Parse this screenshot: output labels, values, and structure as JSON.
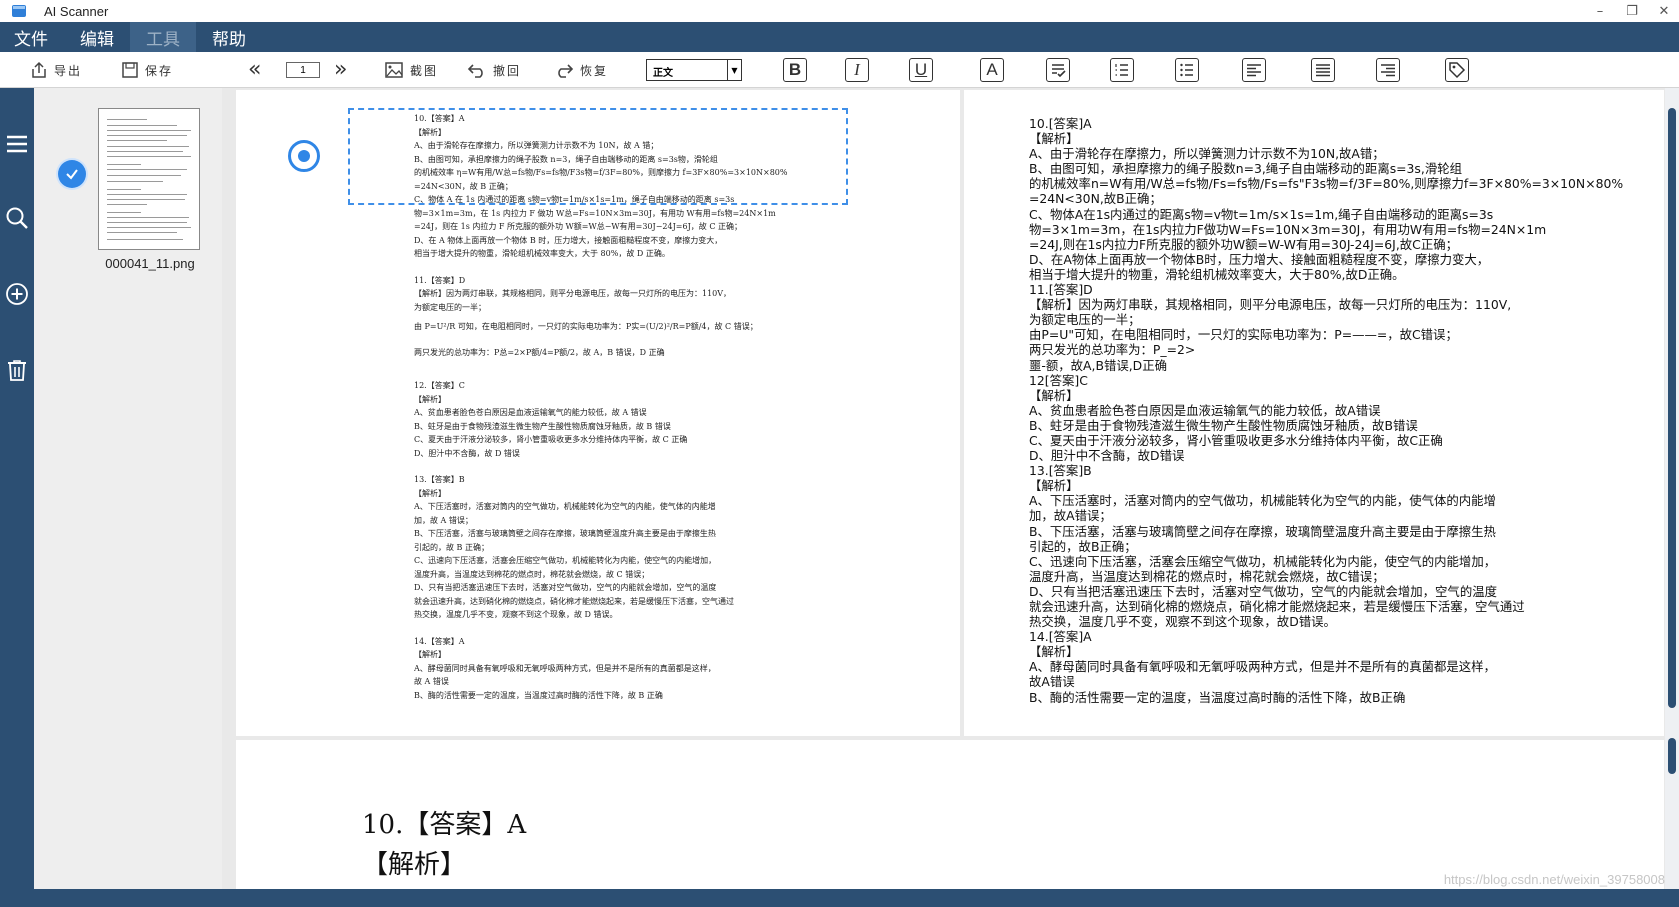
{
  "window": {
    "title": "AI Scanner",
    "minimize": "–",
    "restore": "❐",
    "close": "✕"
  },
  "menu": [
    "文件",
    "编辑",
    "工具",
    "帮助"
  ],
  "toolbar": {
    "export": "导出",
    "save": "保存",
    "page": "1",
    "screenshot": "截图",
    "undo": "撤回",
    "redo": "恢复",
    "style_value": "正文",
    "bold": "B",
    "italic": "I",
    "underline": "U",
    "font_color": "A"
  },
  "sidebar": {
    "thumbnail_name": "000041_11.png"
  },
  "source_doc": [
    "10.【答案】A",
    "【解析】",
    "    A、由于滑轮存在摩擦力，所以弹簧测力计示数不为 10N，故 A 错；",
    "    B、由图可知，承担摩擦力的绳子股数 n=3，绳子自由端移动的距离 s=3s物，滑轮组",
    "的机械效率 η=W有用/W总=fs物/Fs=fs物/F3s物=f/3F=80%，则摩擦力 f=3F×80%=3×10N×80%",
    "=24N<30N，故 B 正确；",
    "    C、物体 A 在 1s 内通过的距离 s物=v物t=1m/s×1s=1m，绳子自由端移动的距离 s=3s",
    "物=3×1m=3m，在 1s 内拉力 F 做功 W总=Fs=10N×3m=30J，有用功 W有用=fs物=24N×1m",
    "=24J，则在 1s 内拉力 F 所克服的额外功 W额=W总−W有用=30J−24J=6J，故 C 正确；",
    "    D、在 A 物体上面再放一个物体 B 时，压力增大，接触面粗糙程度不变，摩擦力变大，",
    "相当于增大提升的物重，滑轮组机械效率变大，大于 80%，故 D 正确。",
    "",
    "11.【答案】D",
    "【解析】因为两灯串联，其规格相同，则平分电源电压，故每一只灯所的电压为：110V，",
    "为额定电压的一半；",
    "由 P=U²/R 可知，在电阻相同时，一只灯的实际电功率为：P实=(U/2)²/R=P额/4，故 C 错误；",
    "两只发光的总功率为：P总=2×P额/4=P额/2，故 A，B 错误，D 正确",
    "",
    "12.【答案】C",
    "【解析】",
    "    A、贫血患者脸色苍白原因是血液运输氧气的能力较低，故 A 错误",
    "    B、蛀牙是由于食物残渣滋生微生物产生酸性物质腐蚀牙釉质，故 B 错误",
    "    C、夏天由于汗液分泌较多，肾小管重吸收更多水分维持体内平衡，故 C 正确",
    "    D、胆汁中不含酶，故 D 错误",
    "",
    "13.【答案】B",
    "【解析】",
    "    A、下压活塞时，活塞对筒内的空气做功，机械能转化为空气的内能，使气体的内能增",
    "加，故 A 错误；",
    "    B、下压活塞，活塞与玻璃筒壁之间存在摩擦，玻璃筒壁温度升高主要是由于摩擦生热",
    "引起的，故 B 正确；",
    "    C、迅速向下压活塞，活塞会压缩空气做功，机械能转化为内能，使空气的内能增加，",
    "温度升高，当温度达到棉花的燃点时，棉花就会燃烧，故 C 错误；",
    "    D、只有当把活塞迅速压下去时，活塞对空气做功，空气的内能就会增加，空气的温度",
    "就会迅速升高，达到硝化棉的燃烧点，硝化棉才能燃烧起来，若是缓慢压下活塞，空气通过",
    "热交换，温度几乎不变，观察不到这个现象，故 D 错误。",
    "",
    "14.【答案】A",
    "【解析】",
    "    A、酵母菌同时具备有氧呼吸和无氧呼吸两种方式，但是并不是所有的真菌都是这样，",
    "故 A 错误",
    "    B、酶的活性需要一定的温度，当温度过高时酶的活性下降，故 B 正确"
  ],
  "ocr_text": [
    "10.[答案]A",
    "【解析】",
    "A、由于滑轮存在摩擦力，所以弹簧测力计示数不为10N,故A错；",
    "B、由图可知，承担摩擦力的绳子股数n=3,绳子自由端移动的距离s=3s,滑轮组",
    "的机械效率n=W有用/W总=fs物/Fs=fs物/Fs=fs\"F3s物=f/3F=80%,则摩擦力f=3F×80%=3×10N×80%",
    "=24N<30N,故B正确；",
    "C、物体A在1s内通过的距离s物=v物t=1m/s×1s=1m,绳子自由端移动的距离s=3s",
    "物=3×1m=3m，在1s内拉力F做功W=Fs=10N×3m=30J，有用功W有用=fs物=24N×1m",
    "=24J,则在1s内拉力F所克服的额外功W额=W-W有用=30J-24J=6J,故C正确；",
    "D、在A物体上面再放一个物体B时，压力增大、接触面粗糙程度不变，摩擦力变大，",
    "相当于增大提升的物重，滑轮组机械效率变大，大于80%,故D正确。",
    "11.[答案]D",
    "【解析】因为两灯串联，其规格相同，则平分电源电压，故每一只灯所的电压为：110V,",
    "为额定电压的一半；",
    "由P=U\"可知，在电阻相同时，一只灯的实际电功率为：P=——=，故C错误；",
    "两只发光的总功率为：P_=2>",
    "噩-额，故A,B错误,D正确",
    "12[答案]C",
    "【解析】",
    "A、贫血患者脸色苍白原因是血液运输氧气的能力较低，故A错误",
    "B、蛀牙是由于食物残渣滋生微生物产生酸性物质腐蚀牙釉质，故B错误",
    "C、夏天由于汗液分泌较多，肾小管重吸收更多水分维持体内平衡，故C正确",
    "D、胆汁中不含酶，故D错误",
    "13.[答案]B",
    "【解析】",
    "A、下压活塞时，活塞对筒内的空气做功，机械能转化为空气的内能，使气体的内能增",
    "加，故A错误；",
    "B、下压活塞，活塞与玻璃筒壁之间存在摩擦，玻璃筒壁温度升高主要是由于摩擦生热",
    "引起的，故B正确；",
    "C、迅速向下压活塞，活塞会压缩空气做功，机械能转化为内能，使空气的内能增加，",
    "温度升高，当温度达到棉花的燃点时，棉花就会燃烧，故C错误；",
    "D、只有当把活塞迅速压下去时，活塞对空气做功，空气的内能就会增加，空气的温度",
    "就会迅速升高，达到硝化棉的燃烧点，硝化棉才能燃烧起来，若是缓慢压下活塞，空气通过",
    "热交换，温度几乎不变，观察不到这个现象，故D错误。",
    "14.[答案]A",
    "【解析】",
    "A、酵母菌同时具备有氧呼吸和无氧呼吸两种方式，但是并不是所有的真菌都是这样，",
    "故A错误",
    "B、酶的活性需要一定的温度，当温度过高时酶的活性下降，故B正确"
  ],
  "zoom_preview": [
    "10.【答案】A",
    "【解析】"
  ],
  "watermark": "https://blog.csdn.net/weixin_39758008",
  "colors": {
    "nav": "#2c4f73",
    "accent": "#2f86e6"
  }
}
